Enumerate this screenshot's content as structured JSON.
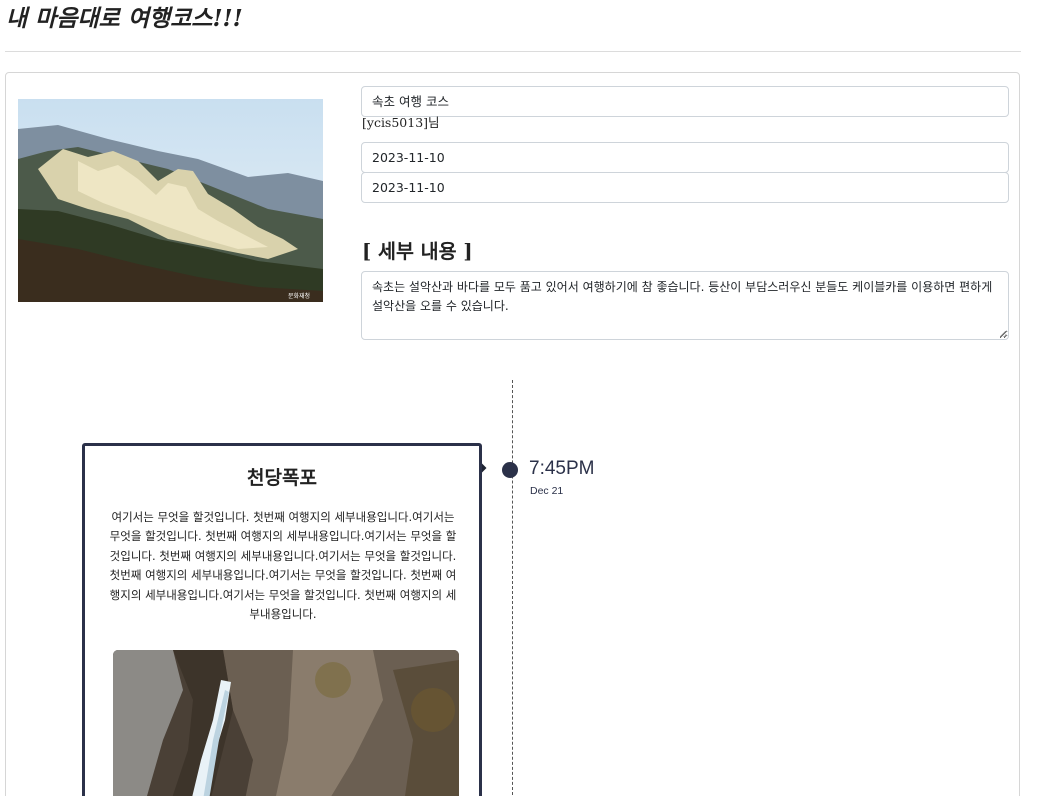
{
  "page": {
    "title": "내 마음대로 여행코스!!!"
  },
  "course": {
    "name": "속초 여행 코스",
    "author": "[ycis5013]님",
    "start_date": "2023-11-10",
    "end_date": "2023-11-10",
    "photo_icon": "mountain-photo",
    "photo_credit": "문화재청",
    "details_heading": "[ 세부 내용 ]",
    "details": "속초는 설악산과 바다를 모두 품고 있어서 여행하기에 참 좋습니다. 등산이 부담스러우신 분들도 케이블카를 이용하면 편하게 설악산을 오를 수 있습니다."
  },
  "timeline": {
    "accent_color": "#2b3149",
    "stops": [
      {
        "title": "천당폭포",
        "time": "7:45PM",
        "date": "Dec 21",
        "description": "여기서는 무엇을 할것입니다. 첫번째 여행지의 세부내용입니다.여기서는 무엇을 할것입니다. 첫번째 여행지의 세부내용입니다.여기서는 무엇을 할것입니다. 첫번째 여행지의 세부내용입니다.여기서는 무엇을 할것입니다. 첫번째 여행지의 세부내용입니다.여기서는 무엇을 할것입니다. 첫번째 여행지의 세부내용입니다.여기서는 무엇을 할것입니다. 첫번째 여행지의 세부내용입니다.",
        "photo_icon": "waterfall-photo"
      }
    ]
  }
}
